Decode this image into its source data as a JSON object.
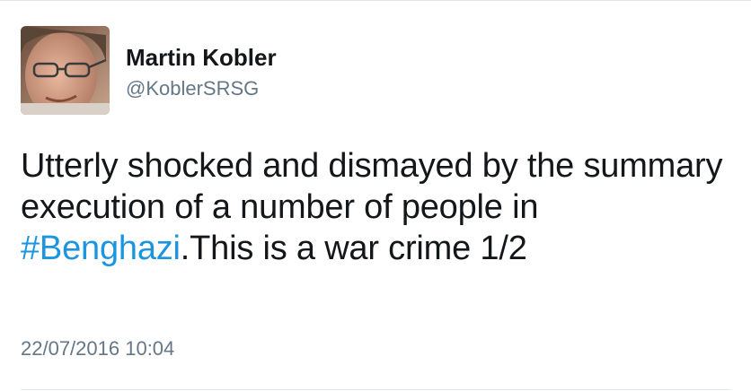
{
  "author": {
    "display_name": "Martin Kobler",
    "handle": "@KoblerSRSG",
    "avatar_icon": "profile-photo"
  },
  "tweet": {
    "text_before": "Utterly shocked and dismayed by the summary execution of a number of people in ",
    "hashtag": "#Benghazi",
    "text_after": ".This is a war crime 1/2",
    "timestamp": "22/07/2016 10:04"
  },
  "colors": {
    "text": "#14171a",
    "secondary_text": "#657786",
    "link": "#1b95e0",
    "divider": "#e1e8ed"
  }
}
